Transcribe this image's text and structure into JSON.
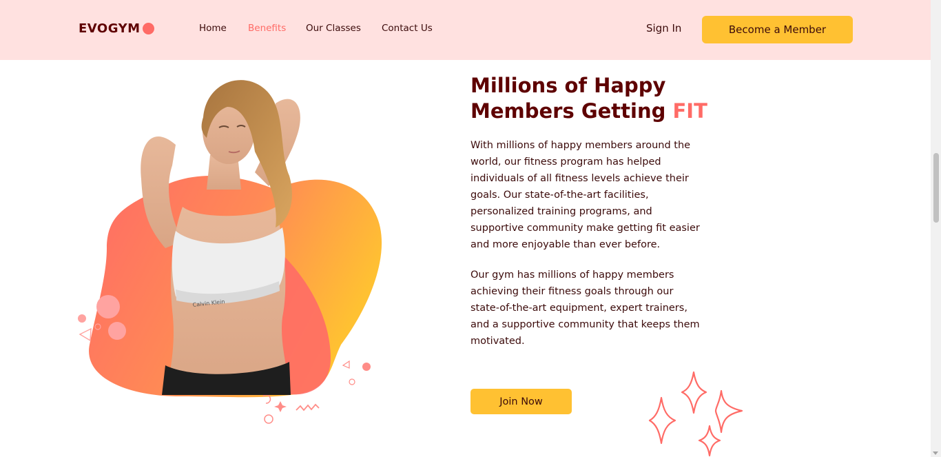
{
  "nav": {
    "logo": "EVOGYM",
    "links": [
      "Home",
      "Benefits",
      "Our Classes",
      "Contact Us"
    ],
    "active_link": "Benefits",
    "sign_in": "Sign In",
    "member_button": "Become a Member"
  },
  "hero": {
    "heading_line1": "Millions of Happy",
    "heading_line2": "Members Getting",
    "heading_highlight": "FIT",
    "paragraph1": "With millions of happy members around the world, our fitness program has helped individuals of all fitness levels achieve their goals. Our state-of-the-art facilities, personalized training programs, and supportive community make getting fit easier and more enjoyable than ever before.",
    "paragraph2": "Our gym has millions of happy members achieving their fitness goals through our state-of-the-art equipment, expert trainers, and a supportive community that keeps them motivated.",
    "join_button": "Join Now",
    "image_text": "Calvin Klein"
  },
  "colors": {
    "nav_bg": "#ffe1e0",
    "primary_text": "#5e0000",
    "accent": "#ff6b66",
    "button": "#ffc132"
  }
}
